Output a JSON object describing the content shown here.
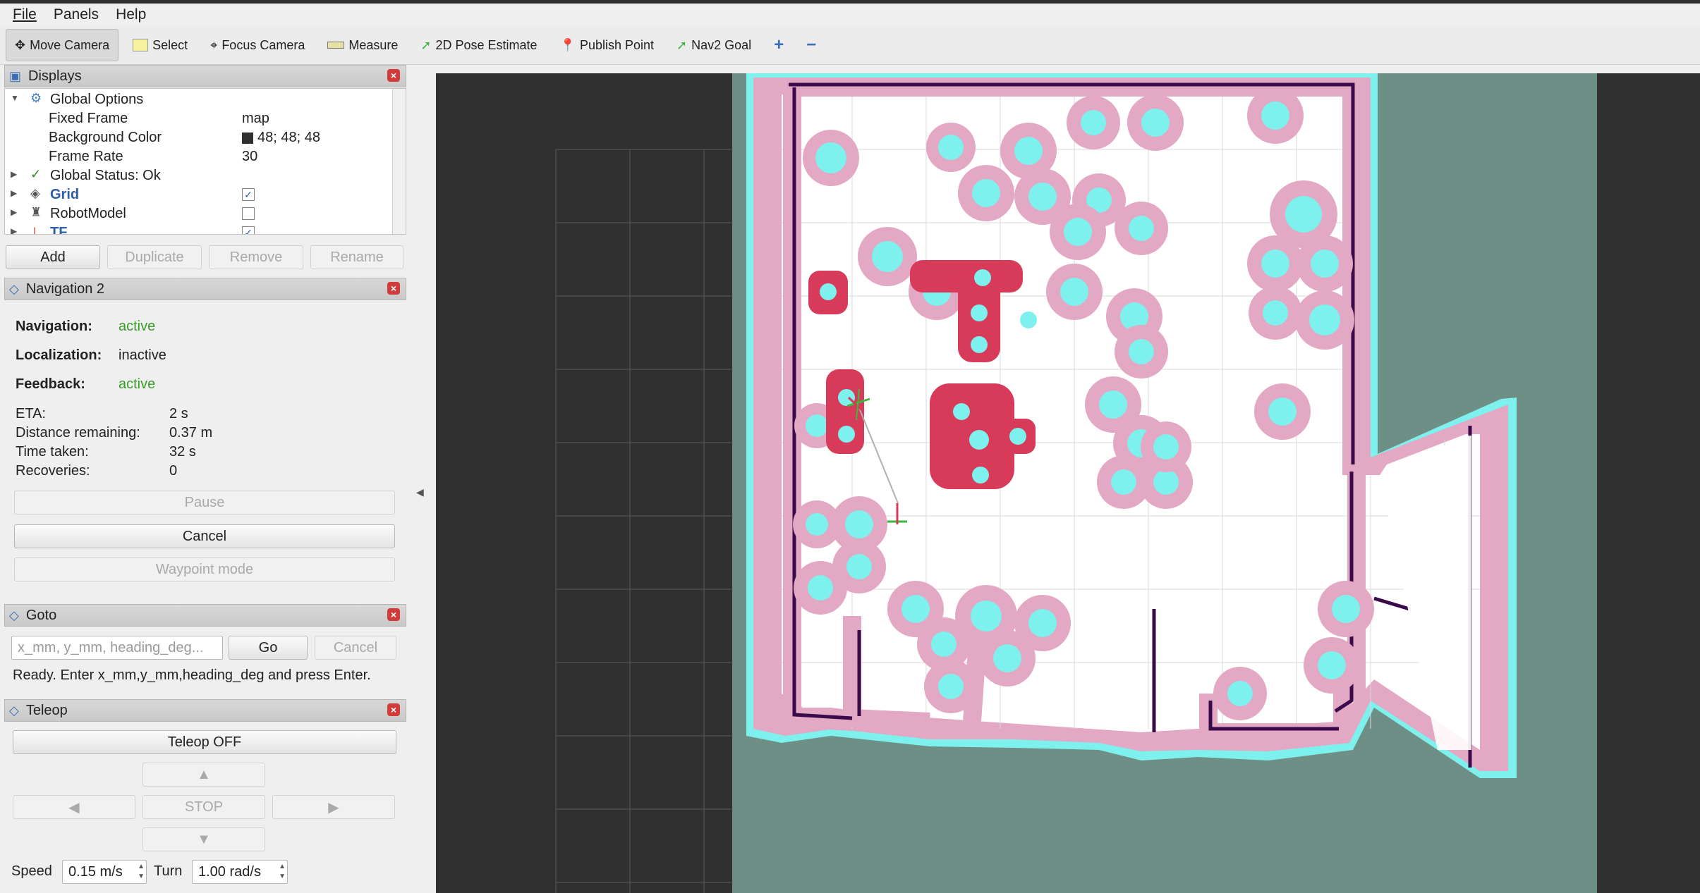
{
  "menu": {
    "file": "File",
    "panels": "Panels",
    "help": "Help"
  },
  "toolbar": {
    "move_camera": "Move Camera",
    "select": "Select",
    "focus_camera": "Focus Camera",
    "measure": "Measure",
    "pose_estimate": "2D Pose Estimate",
    "publish_point": "Publish Point",
    "nav2_goal": "Nav2 Goal"
  },
  "displays": {
    "title": "Displays",
    "rows": [
      {
        "label": "Global Options",
        "value": ""
      },
      {
        "label": "Fixed Frame",
        "value": "map"
      },
      {
        "label": "Background Color",
        "value": "48; 48; 48"
      },
      {
        "label": "Frame Rate",
        "value": "30"
      },
      {
        "label": "Global Status: Ok",
        "value": ""
      },
      {
        "label": "Grid",
        "value": ""
      },
      {
        "label": "RobotModel",
        "value": ""
      },
      {
        "label": "TF",
        "value": ""
      }
    ],
    "buttons": {
      "add": "Add",
      "duplicate": "Duplicate",
      "remove": "Remove",
      "rename": "Rename"
    },
    "background_color": "#303030"
  },
  "navigation": {
    "title": "Navigation 2",
    "navigation_label": "Navigation:",
    "navigation_value": "active",
    "localization_label": "Localization:",
    "localization_value": "inactive",
    "feedback_label": "Feedback:",
    "feedback_value": "active",
    "eta_label": "ETA:",
    "eta_value": "2 s",
    "distance_label": "Distance remaining:",
    "distance_value": "0.37 m",
    "time_label": "Time taken:",
    "time_value": "32 s",
    "recoveries_label": "Recoveries:",
    "recoveries_value": "0",
    "pause": "Pause",
    "cancel": "Cancel",
    "waypoint": "Waypoint mode"
  },
  "goto": {
    "title": "Goto",
    "placeholder": "x_mm, y_mm, heading_deg...",
    "go": "Go",
    "cancel": "Cancel",
    "status": "Ready. Enter x_mm,y_mm,heading_deg and press Enter."
  },
  "teleop": {
    "title": "Teleop",
    "toggle": "Teleop OFF",
    "up": "▲",
    "left": "◀",
    "stop": "STOP",
    "right": "▶",
    "down": "▼",
    "speed_label": "Speed",
    "speed_value": "0.15 m/s",
    "turn_label": "Turn",
    "turn_value": "1.00 rad/s"
  },
  "colors": {
    "costmap_pink": "#e3a8c4",
    "inflation_cyan": "#7ef0ee",
    "lethal_red": "#d83a5a",
    "obstacle_purple": "#3a0a4a",
    "unknown": "#6e8f86",
    "free": "#ffffff"
  }
}
